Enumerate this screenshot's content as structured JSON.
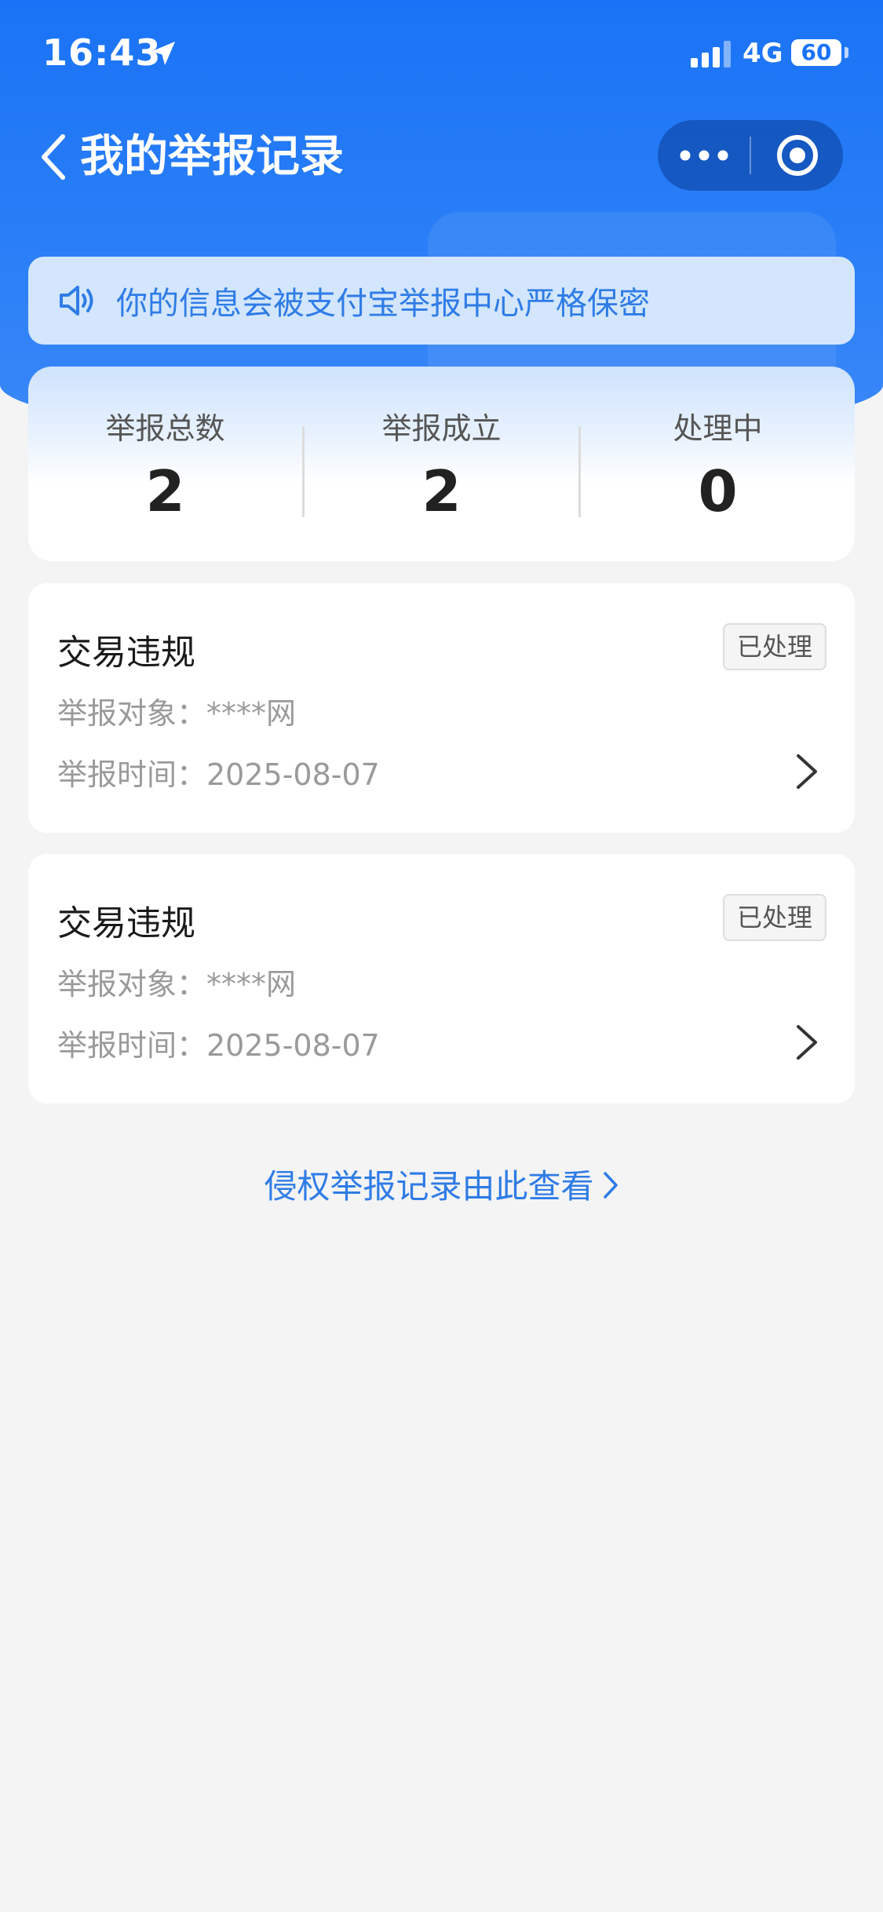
{
  "status_bar": {
    "time": "16:43",
    "network": "4G",
    "battery": "60"
  },
  "nav": {
    "title": "我的举报记录"
  },
  "notice": {
    "text": "你的信息会被支付宝举报中心严格保密"
  },
  "stats": [
    {
      "label": "举报总数",
      "value": "2"
    },
    {
      "label": "举报成立",
      "value": "2"
    },
    {
      "label": "处理中",
      "value": "0"
    }
  ],
  "records": [
    {
      "type": "交易违规",
      "status": "已处理",
      "target": "举报对象：****网",
      "time": "举报时间：2025-08-07"
    },
    {
      "type": "交易违规",
      "status": "已处理",
      "target": "举报对象：****网",
      "time": "举报时间：2025-08-07"
    }
  ],
  "footer": {
    "infringement_link": "侵权举报记录由此查看"
  },
  "colors": {
    "primary": "#1a73f6",
    "link": "#2f7ce6",
    "page_bg": "#f4f4f5"
  }
}
